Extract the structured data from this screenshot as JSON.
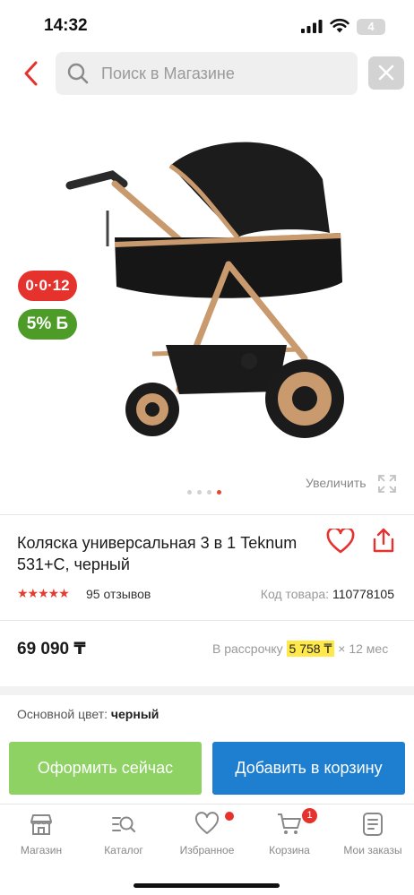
{
  "status_bar": {
    "time": "14:32",
    "battery": "4"
  },
  "search": {
    "placeholder": "Поиск в Магазине"
  },
  "gallery": {
    "badge_installment": "0·0·12",
    "badge_bonus": "5% Б",
    "zoom_label": "Увеличить",
    "dots_total": 4,
    "active_dot": 4
  },
  "product": {
    "title": "Коляска универсальная 3 в 1 Teknum 531+C, черный",
    "rating_stars": 5,
    "reviews": "95 отзывов",
    "code_label": "Код товара:",
    "code_value": "110778105",
    "price": "69 090 ₸",
    "installment_prefix": "В рассрочку",
    "installment_amount": "5 758 ₸",
    "installment_suffix": "× 12 мес",
    "color_label": "Основной цвет:",
    "color_value": "черный"
  },
  "actions": {
    "buy_now": "Оформить сейчас",
    "add_to_cart": "Добавить в корзину"
  },
  "nav": {
    "items": [
      {
        "label": "Магазин"
      },
      {
        "label": "Каталог"
      },
      {
        "label": "Избранное"
      },
      {
        "label": "Корзина",
        "badge": "1"
      },
      {
        "label": "Мои заказы"
      }
    ]
  },
  "colors": {
    "accent_red": "#e5322c",
    "cart_blue": "#1e7ecf",
    "buy_green": "#8dd262",
    "bonus_green": "#4c9c27"
  }
}
